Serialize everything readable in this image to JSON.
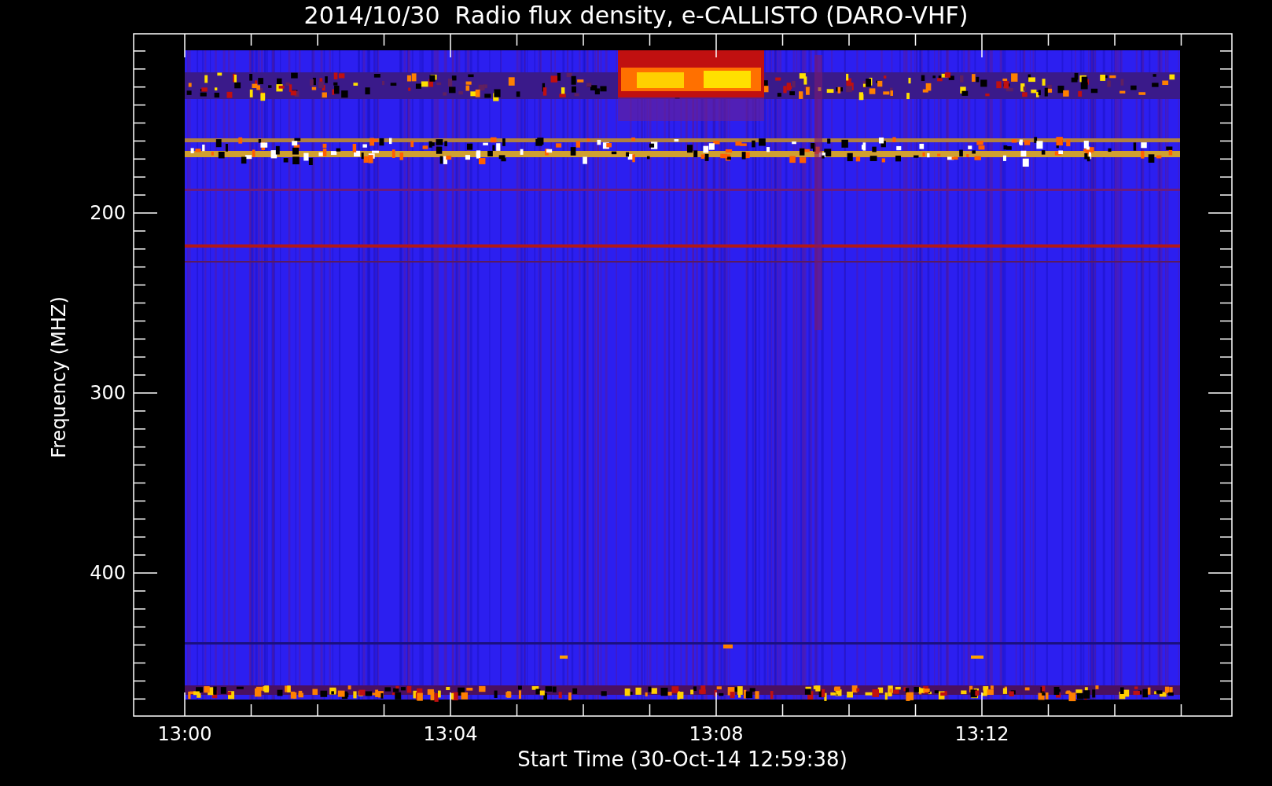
{
  "title": "2014/10/30  Radio flux density, e-CALLISTO (DARO-VHF)",
  "x_axis": {
    "label": "Start Time (30-Oct-14 12:59:38)",
    "ticks": [
      "13:00",
      "13:04",
      "13:08",
      "13:12"
    ]
  },
  "y_axis": {
    "label": "Frequency (MHZ)",
    "ticks": [
      "200",
      "300",
      "400"
    ]
  }
}
